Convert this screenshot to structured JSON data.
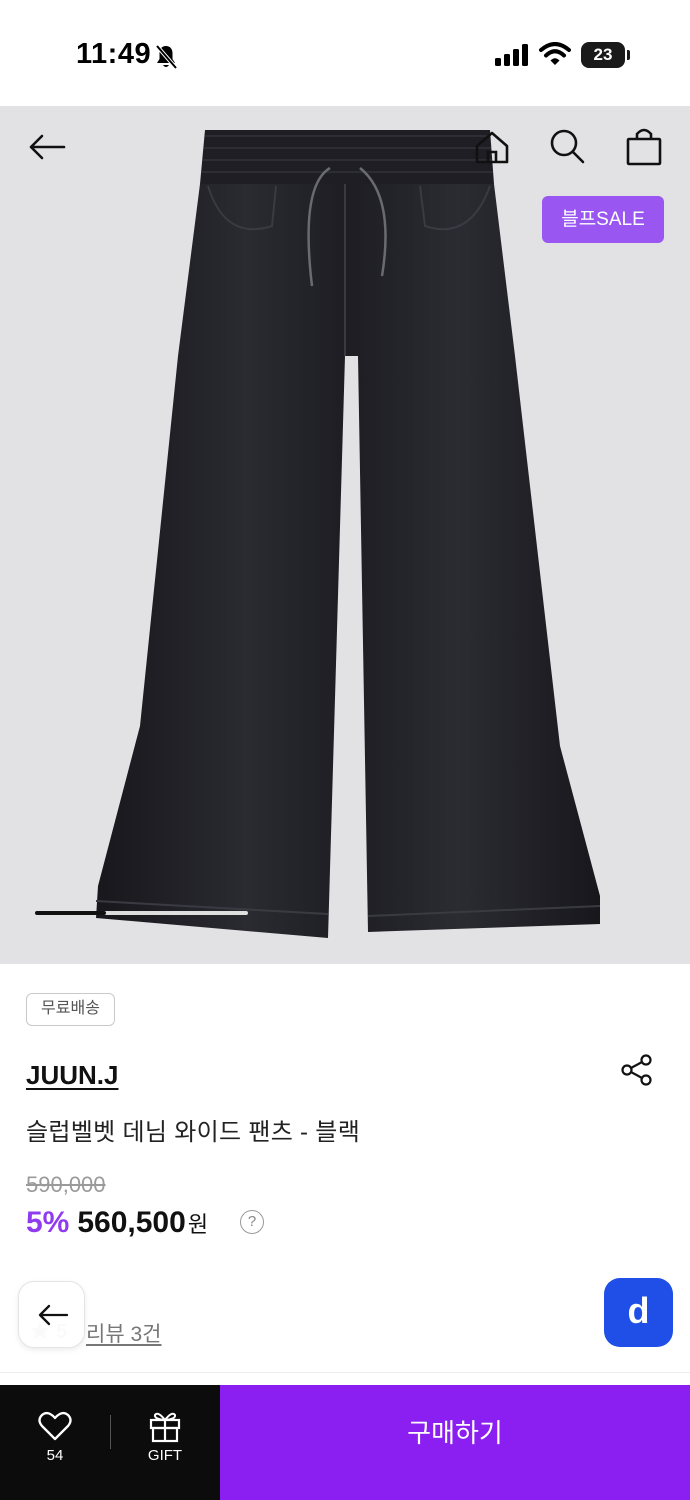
{
  "status_bar": {
    "time": "11:49",
    "battery": "23"
  },
  "product_image": {
    "badge": "블프SALE",
    "page_current": 1,
    "page_total": 3
  },
  "product": {
    "shipping_tag": "무료배송",
    "brand": "JUUN.J",
    "name": "슬럽벨벳 데님 와이드 팬츠 - 블랙",
    "original_price": "590,000",
    "discount": "5%",
    "price": "560,500",
    "currency": "원",
    "help": "?"
  },
  "reviews": {
    "rating": "5",
    "label": "리뷰 3건"
  },
  "floating": {
    "d_label": "d"
  },
  "bottom_bar": {
    "like_count": "54",
    "gift_label": "GIFT",
    "buy_label": "구매하기"
  },
  "colors": {
    "accent": "#8b1ef0",
    "discount": "#8f3cf0",
    "badge": "#9a56f0",
    "d_button": "#1f4fe6"
  },
  "icons": [
    "bell-slash-icon",
    "signal-icon",
    "wifi-icon",
    "battery-icon",
    "back-arrow-icon",
    "home-icon",
    "search-icon",
    "bag-icon",
    "share-icon",
    "help-icon",
    "star-icon",
    "heart-icon",
    "gift-icon"
  ]
}
